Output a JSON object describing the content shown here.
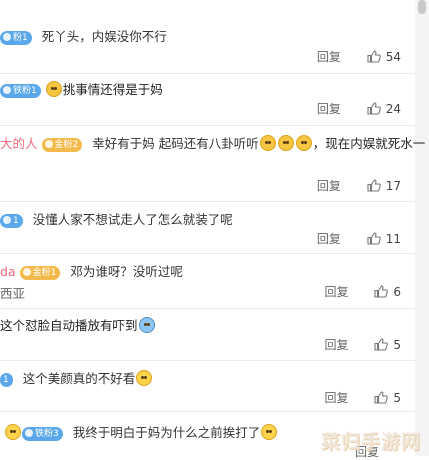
{
  "reply_label": "回复",
  "comments": [
    {
      "name": "",
      "badge": "粉1",
      "badge_color": "blue",
      "text": "死丫头，内娱没你不行",
      "likes": "54"
    },
    {
      "name": "",
      "badge": "铁粉1",
      "badge_color": "blue",
      "text": "挑事情还得是于妈",
      "likes": "24"
    },
    {
      "name": "大的人",
      "badge": "金粉2",
      "badge_color": "gold",
      "text": "幸好有于妈 起码还有八卦听听",
      "text_after": "，现在内娱就死水一",
      "likes": "17"
    },
    {
      "name": "",
      "badge": "1",
      "badge_color": "blue",
      "text": "没懂人家不想试走人了怎么就装了呢",
      "likes": "11"
    },
    {
      "name": "da",
      "badge": "金粉1",
      "badge_color": "gold",
      "text": "邓为谁呀？没听过呢",
      "subtext": "西亚",
      "likes": "6"
    },
    {
      "name": "",
      "badge": "",
      "badge_color": "blue",
      "text": "这个怼脸自动播放有吓到",
      "likes": "5"
    },
    {
      "name": "",
      "badge": "1",
      "badge_color": "blue",
      "text": "这个美颜真的不好看",
      "likes": "5"
    },
    {
      "name": "",
      "badge": "铁粉3",
      "badge_color": "blue",
      "text": "我终于明白于妈为什么之前挨打了",
      "likes": ""
    }
  ],
  "watermark": "菜归手游网"
}
